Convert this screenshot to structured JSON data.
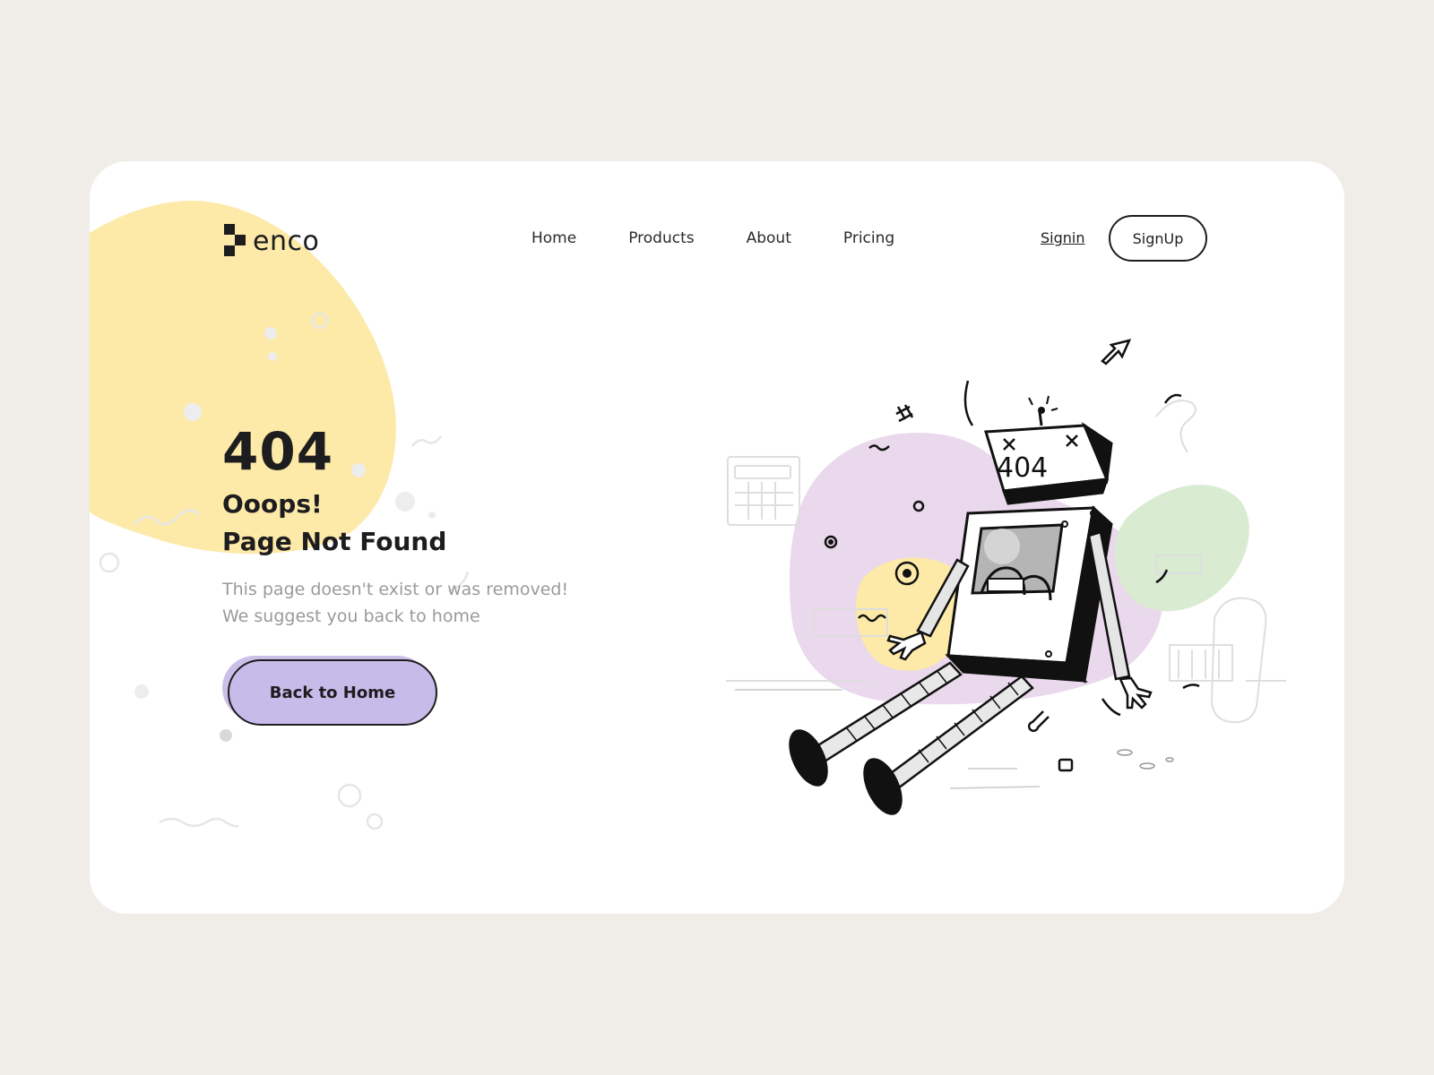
{
  "brand": {
    "name": "enco"
  },
  "nav": {
    "items": [
      {
        "label": "Home"
      },
      {
        "label": "Products"
      },
      {
        "label": "About"
      },
      {
        "label": "Pricing"
      }
    ]
  },
  "auth": {
    "signin_label": "Signin",
    "signup_label": "SignUp"
  },
  "hero": {
    "code": "404",
    "title_line1": "Ooops!",
    "title_line2": "Page Not Found",
    "subtitle_line1": "This page doesn't exist or was removed!",
    "subtitle_line2": "We suggest you back to home",
    "cta_label": "Back to Home"
  },
  "illustration": {
    "screen_text": "404",
    "icon": "broken-robot-illustration"
  },
  "colors": {
    "background": "#f0ede8",
    "card": "#ffffff",
    "yellow_blob": "#fde9a8",
    "purple_blob": "#ead8ec",
    "green_blob": "#d9ecd1",
    "button": "#c7bbea",
    "text_dark": "#1d1d1f",
    "text_muted": "#9a9a9a"
  }
}
